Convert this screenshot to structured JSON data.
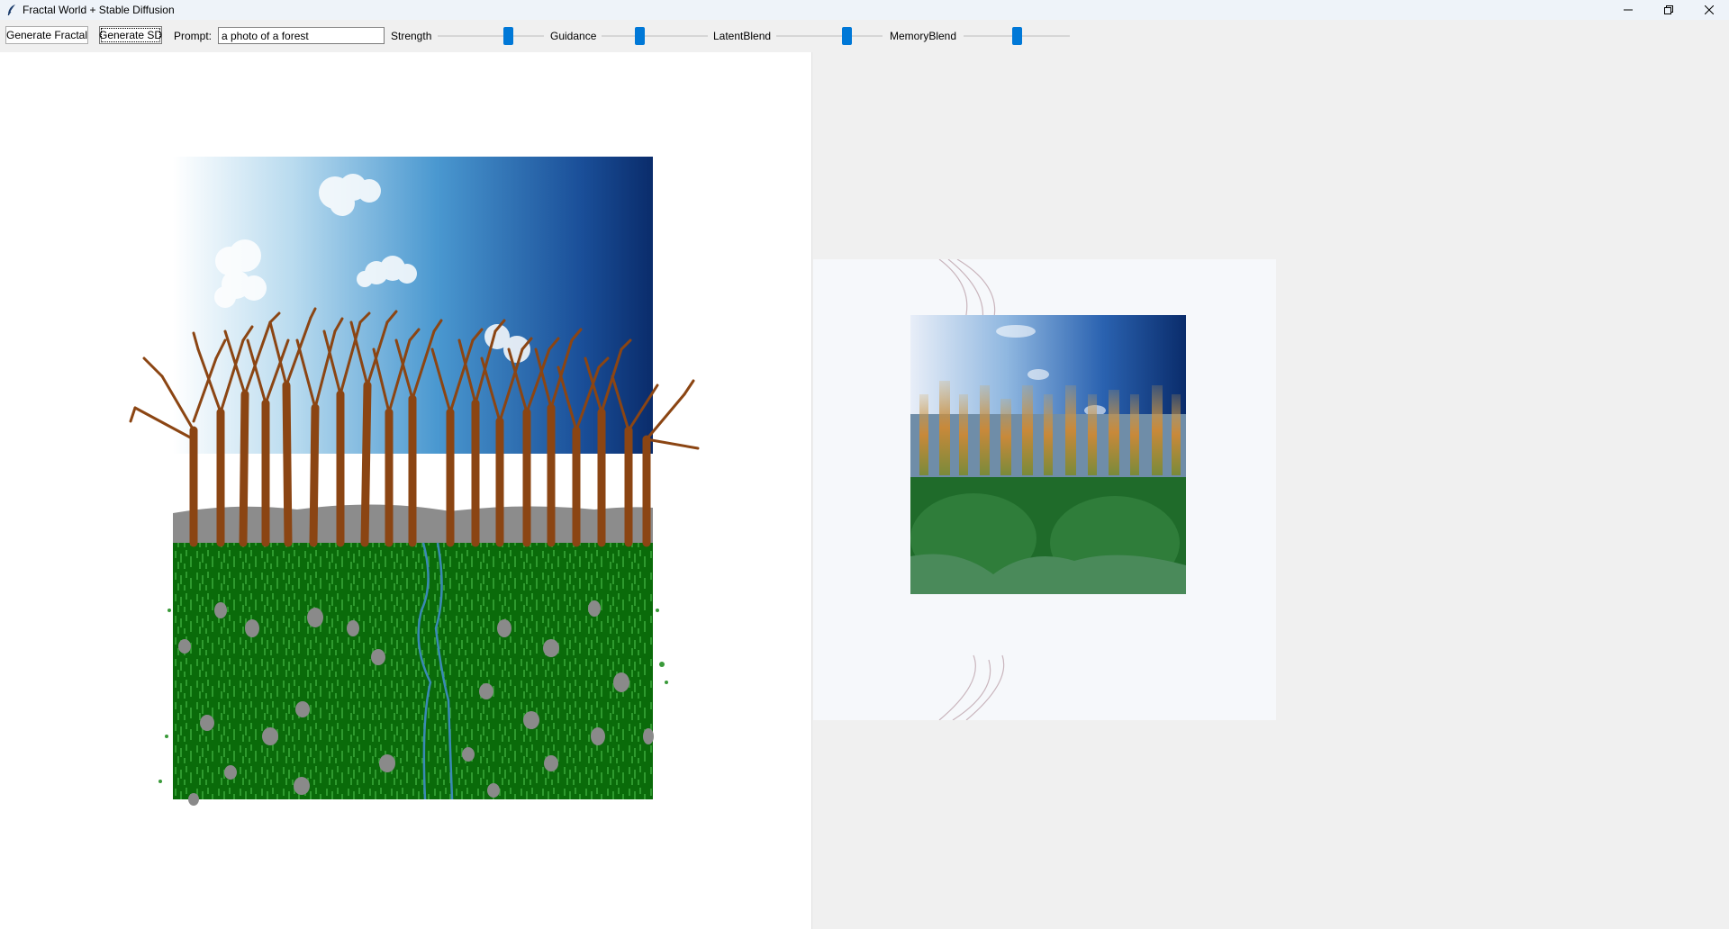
{
  "window": {
    "title": "Fractal World + Stable Diffusion",
    "icon": "feather-icon",
    "controls": [
      "minimize-icon",
      "restore-icon",
      "close-icon"
    ]
  },
  "toolbar": {
    "generate_fractal_label": "Generate Fractal",
    "generate_sd_label": "Generate SD",
    "prompt_label": "Prompt:",
    "prompt_value": "a photo of a forest",
    "sliders": [
      {
        "label": "Strength",
        "value": 0.68
      },
      {
        "label": "Guidance",
        "value": 0.35
      },
      {
        "label": "LatentBlend",
        "value": 0.68
      },
      {
        "label": "MemoryBlend",
        "value": 0.5
      }
    ]
  },
  "colors": {
    "accent": "#0078d7",
    "sky_top_right": "#0a2c6b",
    "tree_brown": "#8b4513",
    "grass_green": "#0a6b0a",
    "stone_gray": "#808080"
  }
}
